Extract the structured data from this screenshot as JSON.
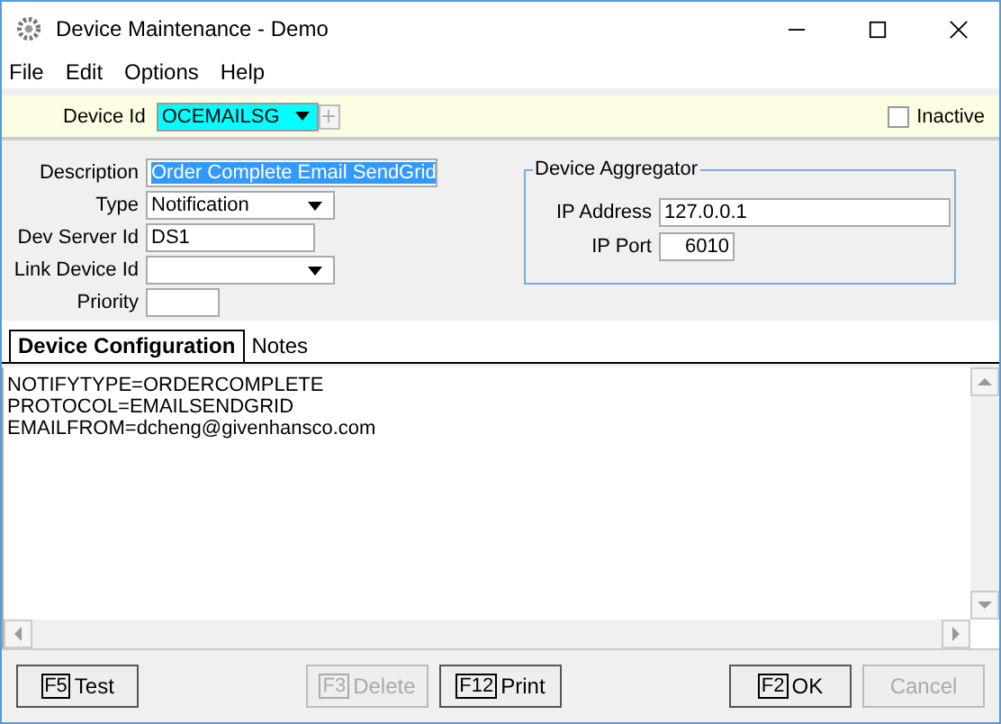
{
  "window": {
    "title": "Device Maintenance - Demo"
  },
  "menu": [
    "File",
    "Edit",
    "Options",
    "Help"
  ],
  "device_id": {
    "label": "Device Id",
    "value": "OCEMAILSG"
  },
  "inactive": {
    "label": "Inactive",
    "checked": false
  },
  "fields": [
    {
      "label": "Description",
      "value": "Order Complete Email SendGrid",
      "kind": "highlighted"
    },
    {
      "label": "Type",
      "value": "Notification",
      "kind": "dropdown"
    },
    {
      "label": "Dev Server Id",
      "value": "DS1",
      "kind": "text"
    },
    {
      "label": "Link Device Id",
      "kind": "dropdown"
    },
    {
      "label": "Priority",
      "kind": "short"
    }
  ],
  "aggregator": {
    "title": "Device Aggregator",
    "ip_address_label": "IP Address",
    "ip_address": "127.0.0.1",
    "ip_port_label": "IP Port",
    "ip_port": "6010"
  },
  "tabs": [
    {
      "label": "Device Configuration",
      "selected": true
    },
    {
      "label": "Notes",
      "selected": false
    }
  ],
  "config_lines": [
    "NOTIFYTYPE=ORDERCOMPLETE",
    "PROTOCOL=EMAILSENDGRID",
    "EMAILFROM=dcheng@givenhansco.com"
  ],
  "button_groups": [
    [
      {
        "key": "F5",
        "label": "Test",
        "disabled": false
      }
    ],
    [
      {
        "key": "F3",
        "label": "Delete",
        "disabled": true
      },
      {
        "key": "F12",
        "label": "Print",
        "disabled": false
      }
    ],
    [
      {
        "key": "F2",
        "label": "OK",
        "disabled": false
      },
      {
        "label": "Cancel",
        "disabled": true
      }
    ]
  ]
}
